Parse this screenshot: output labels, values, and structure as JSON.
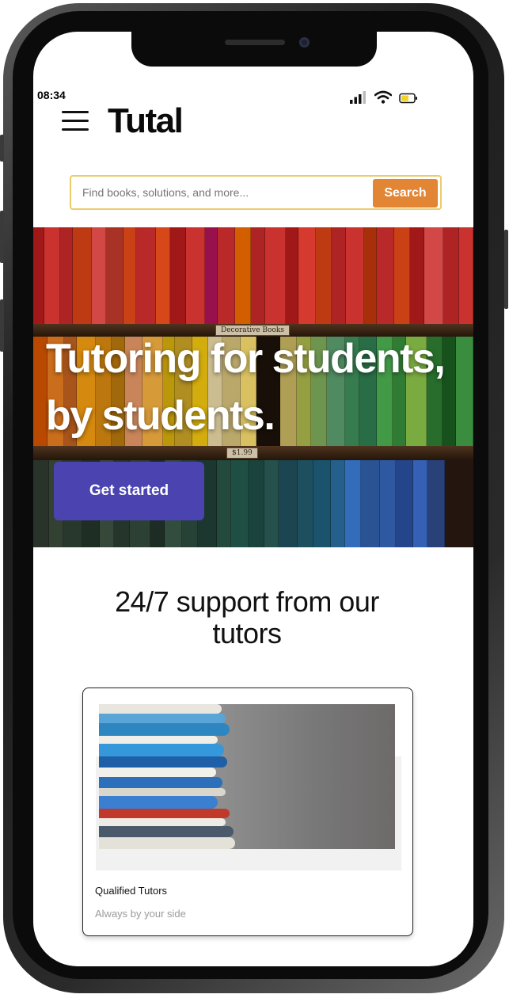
{
  "status_bar": {
    "time": "08:34"
  },
  "header": {
    "brand": "Tutal"
  },
  "search": {
    "placeholder": "Find books, solutions, and more...",
    "button_label": "Search"
  },
  "hero": {
    "title_line1": "Tutoring for students,",
    "title_line2": "by students.",
    "cta_label": "Get started",
    "shelf_labels": [
      "Decorative Books",
      "$1.99"
    ]
  },
  "support": {
    "title_line1": "24/7 support from our",
    "title_line2": "tutors"
  },
  "feature_card": {
    "title": "Qualified Tutors",
    "subtitle": "Always by your side"
  },
  "colors": {
    "accent": "#e28636",
    "cta": "#4a43b0",
    "search_border": "#eccb6a"
  },
  "icons": [
    "menu-icon",
    "signal-icon",
    "wifi-icon",
    "battery-icon"
  ]
}
